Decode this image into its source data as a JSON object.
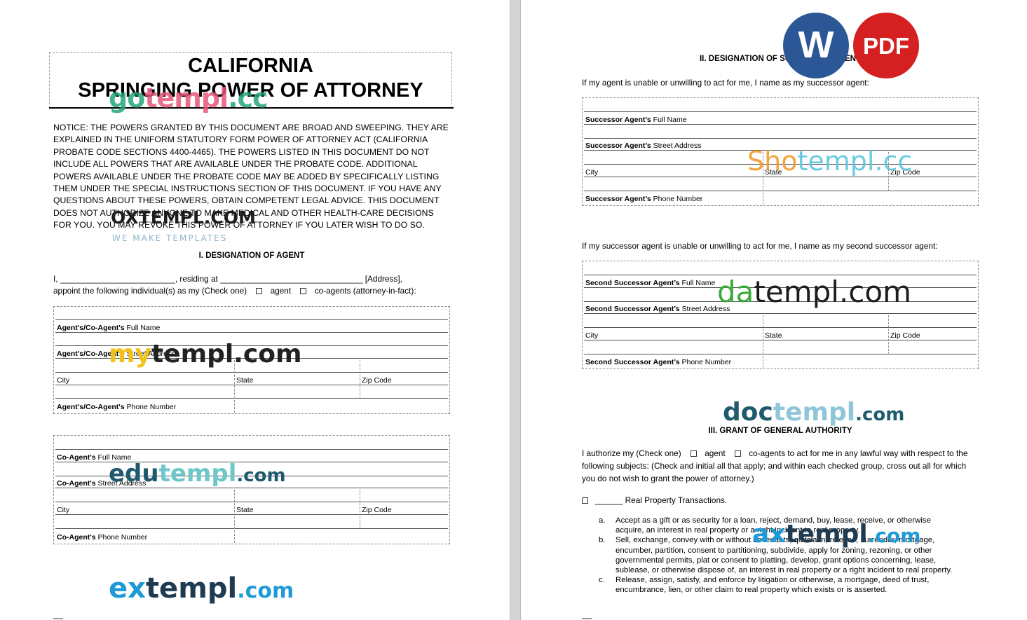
{
  "left_page": {
    "title_line1": "CALIFORNIA",
    "title_line2": "SPRINGING POWER OF ATTORNEY",
    "notice_lines": [
      "NOTICE:  THE POWERS GRANTED BY THIS DOCUMENT ARE BROAD AND SWEEPING. THEY ARE",
      "EXPLAINED IN THE UNIFORM STATUTORY FORM POWER OF ATTORNEY ACT (CALIFORNIA",
      "PROBATE CODE SECTIONS 4400-4465). THE POWERS LISTED IN THIS DOCUMENT DO NOT",
      "INCLUDE ALL POWERS THAT ARE AVAILABLE UNDER THE PROBATE CODE. ADDITIONAL",
      "POWERS AVAILABLE UNDER THE PROBATE CODE MAY BE ADDED BY SPECIFICALLY LISTING",
      "THEM UNDER THE SPECIAL INSTRUCTIONS SECTION OF THIS DOCUMENT. IF YOU HAVE ANY",
      "QUESTIONS ABOUT THESE POWERS, OBTAIN COMPETENT LEGAL ADVICE. THIS DOCUMENT",
      "DOES NOT AUTHORIZE ANYONE TO MAKE MEDICAL AND OTHER HEALTH-CARE DECISIONS",
      "FOR YOU. YOU MAY REVOKE THIS POWER OF ATTORNEY IF YOU LATER WISH TO DO SO."
    ],
    "section1_heading": "I. DESIGNATION OF AGENT",
    "intro_line1": "I, _________________________, residing at _______________________________ [Address],",
    "intro_line2_a": "appoint the following individual(s) as my (Check one)",
    "intro_line2_b": "agent",
    "intro_line2_c": "co-agents (attorney-in-fact):",
    "agent_form": {
      "full_name_bold": "Agent's/Co-Agent's",
      "full_name_rest": " Full Name",
      "street_bold": "Agent's/Co-Agent's",
      "street_rest": " Street Address",
      "city": "City",
      "state": "State",
      "zip": "Zip Code",
      "phone_bold": "Agent's/Co-Agent's",
      "phone_rest": " Phone Number"
    },
    "coagent_form": {
      "full_name_bold": "Co-Agent's",
      "full_name_rest": " Full Name",
      "street_bold": "Co-Agent's",
      "street_rest": " Street Address",
      "city": "City",
      "state": "State",
      "zip": "Zip Code",
      "phone_bold": "Co-Agent's",
      "phone_rest": " Phone Number"
    }
  },
  "right_page": {
    "section2_heading": "II. DESIGNATION OF SUCCESSOR AGENT",
    "successor_intro": "If my agent is unable or unwilling to act for me, I name as my successor agent:",
    "successor_form": {
      "full_name": "Successor Agent's Full Name",
      "street": "Successor Agent's Street Address",
      "city": "City",
      "state": "State",
      "zip": "Zip Code",
      "phone": "Successor Agent's Phone Number"
    },
    "second_intro": "If my successor agent is unable or unwilling to act for me, I name as my second successor agent:",
    "second_form": {
      "full_name": "Second Successor Agent's Full Name",
      "street": "Second Successor Agent's Street Address",
      "city": "City",
      "state": "State",
      "zip": "Zip Code",
      "phone": "Second Successor Agent's Phone Number"
    },
    "section3_heading": "III. GRANT OF GENERAL AUTHORITY",
    "grant_line1_a": "I authorize my (Check one)",
    "grant_line1_b": "agent",
    "grant_line1_c": "co-agents to act for me in any lawful way with respect to the",
    "grant_line2": "following subjects: (Check and initial all that apply; and within each checked group, cross out all for which",
    "grant_line3": "you do not wish to grant the power of attorney.)",
    "real_property_label": "______ Real Property Transactions.",
    "items": [
      {
        "marker": "a.",
        "lines": [
          "Accept as a gift or as security for a loan, reject, demand, buy, lease, receive, or otherwise",
          "acquire, an interest in real property or a right incident to real property."
        ]
      },
      {
        "marker": "b.",
        "lines": [
          "Sell, exchange, convey with or without covenants, quitclaim, release, surrender, mortgage,",
          "encumber, partition, consent to partitioning, subdivide, apply for zoning, rezoning, or other",
          "governmental permits, plat or consent to platting, develop, grant options concerning, lease,",
          "sublease, or otherwise dispose of, an interest in real property or a right incident to real property."
        ]
      },
      {
        "marker": "c.",
        "lines": [
          "Release, assign, satisfy, and enforce by litigation or otherwise, a mortgage, deed of trust,",
          "encumbrance, lien, or other claim to real property which exists or is asserted."
        ]
      }
    ]
  },
  "badges": {
    "word_label": "W",
    "pdf_label": "PDF",
    "word_color": "#2b5797",
    "pdf_color": "#d42020"
  },
  "watermarks": {
    "gotempl_a": "go",
    "gotempl_b": "templ",
    "gotempl_c": ".cc",
    "oxtempl": "OXTEMPL.COM",
    "oxtempl_tag": "WE MAKE TEMPLATES",
    "mytempl_a": "my",
    "mytempl_b": "templ.com",
    "edutempl_a": "edu",
    "edutempl_b": "templ",
    "edutempl_c": ".com",
    "extempl_a": "ex",
    "extempl_b": "templ",
    "extempl_c": ".com",
    "shotempl_a": "Sho",
    "shotempl_b": "templ.cc",
    "datempl_a": "da",
    "datempl_b": "templ.com",
    "doctempl_a": "doc",
    "doctempl_b": "templ",
    "doctempl_c": ".com",
    "axtempl_a": "ax",
    "axtempl_b": "templ",
    "axtempl_c": ".com"
  }
}
